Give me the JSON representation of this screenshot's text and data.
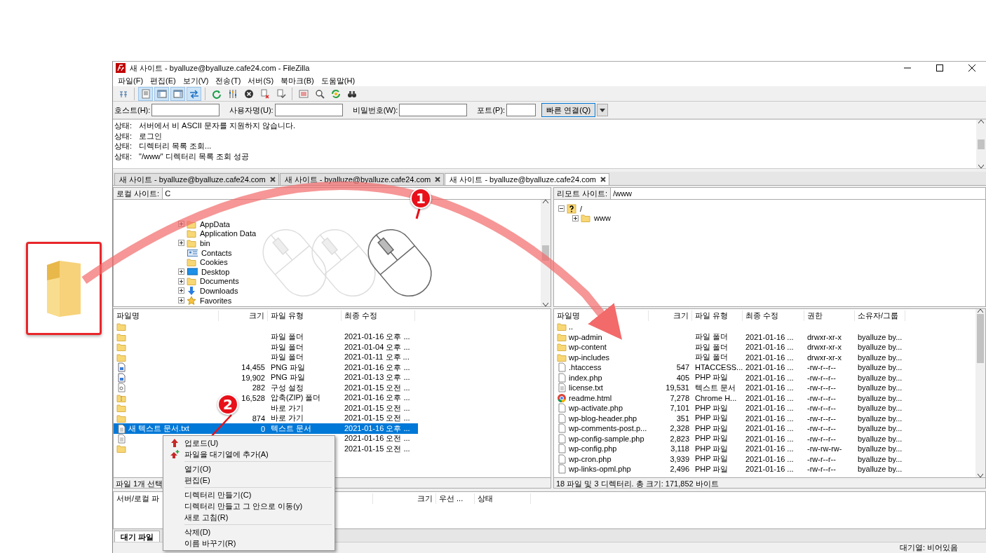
{
  "window": {
    "title": "새 사이트 - byalluze@byalluze.cafe24.com - FileZilla"
  },
  "menu": [
    "파일(F)",
    "편집(E)",
    "보기(V)",
    "전송(T)",
    "서버(S)",
    "북마크(B)",
    "도움말(H)"
  ],
  "toolbar": [
    {
      "kind": "site-manager",
      "on": false
    },
    {
      "kind": "log",
      "on": true
    },
    {
      "kind": "local-tree",
      "on": true
    },
    {
      "kind": "remote-tree",
      "on": true
    },
    {
      "kind": "queue",
      "on": true
    },
    {
      "kind": "refresh",
      "on": false
    },
    {
      "kind": "filter",
      "on": false
    },
    {
      "kind": "cancel",
      "on": false
    },
    {
      "kind": "disconnect",
      "on": false
    },
    {
      "kind": "reconnect",
      "on": false
    },
    {
      "kind": "listing",
      "on": false
    },
    {
      "kind": "search",
      "on": false
    },
    {
      "kind": "sync",
      "on": false
    },
    {
      "kind": "find",
      "on": false
    }
  ],
  "quickconnect": {
    "fields": [
      {
        "label": "호스트(H):"
      },
      {
        "label": "사용자명(U):"
      },
      {
        "label": "비밀번호(W):"
      },
      {
        "label": "포트(P):"
      }
    ],
    "button": "빠른 연결(Q)"
  },
  "log": [
    {
      "label": "상태:",
      "text": "서버에서 비 ASCII 문자를 지원하지 않습니다."
    },
    {
      "label": "상태:",
      "text": "로그인"
    },
    {
      "label": "상태:",
      "text": "디렉터리 목록 조회..."
    },
    {
      "label": "상태:",
      "text": "\"/www\" 디렉터리 목록 조회 성공"
    }
  ],
  "tabs": [
    {
      "label": "새 사이트 - byalluze@byalluze.cafe24.com",
      "selected": false
    },
    {
      "label": "새 사이트 - byalluze@byalluze.cafe24.com",
      "selected": false
    },
    {
      "label": "새 사이트 - byalluze@byalluze.cafe24.com",
      "selected": true
    }
  ],
  "local": {
    "site_label": "로컬 사이트:",
    "path": "C",
    "tree": [
      {
        "name": "AppData",
        "kind": "folder",
        "expandable": true
      },
      {
        "name": "Application Data",
        "kind": "folder",
        "expandable": false
      },
      {
        "name": "bin",
        "kind": "folder",
        "expandable": true
      },
      {
        "name": "Contacts",
        "kind": "contacts",
        "expandable": false
      },
      {
        "name": "Cookies",
        "kind": "folder",
        "expandable": false
      },
      {
        "name": "Desktop",
        "kind": "desktop",
        "expandable": true
      },
      {
        "name": "Documents",
        "kind": "folder",
        "expandable": true
      },
      {
        "name": "Downloads",
        "kind": "downloads",
        "expandable": true
      },
      {
        "name": "Favorites",
        "kind": "favorites",
        "expandable": true
      }
    ],
    "columns": [
      "파일명",
      "크기",
      "파일 유형",
      "최종 수정"
    ],
    "rows": [
      {
        "kind": "folder",
        "selected": false
      },
      {
        "kind": "folder",
        "type": "파일 폴더",
        "modified": "2021-01-16 오후 ...",
        "selected": false
      },
      {
        "kind": "folder",
        "type": "파일 폴더",
        "modified": "2021-01-04 오후 ...",
        "selected": false
      },
      {
        "kind": "folder",
        "type": "파일 폴더",
        "modified": "2021-01-11 오후 ...",
        "selected": false
      },
      {
        "kind": "image",
        "size": "14,455",
        "type": "PNG 파일",
        "modified": "2021-01-16 오후 ...",
        "selected": false
      },
      {
        "kind": "image",
        "size": "19,902",
        "type": "PNG 파일",
        "modified": "2021-01-13 오후 ...",
        "selected": false
      },
      {
        "kind": "config",
        "size": "282",
        "type": "구성 설정",
        "modified": "2021-01-15 오전 ...",
        "selected": false
      },
      {
        "kind": "zip",
        "size": "16,528",
        "type": "압축(ZIP) 폴더",
        "modified": "2021-01-16 오후 ...",
        "selected": false
      },
      {
        "kind": "folder",
        "type": "바로 가기",
        "modified": "2021-01-15 오전 ...",
        "selected": false
      },
      {
        "kind": "folder",
        "size": "874",
        "type": "바로 가기",
        "modified": "2021-01-15 오전 ...",
        "selected": false
      },
      {
        "kind": "text",
        "name": "새 텍스트 문서.txt",
        "size": "0",
        "type": "텍스트 문서",
        "modified": "2021-01-16 오후 ...",
        "selected": true
      },
      {
        "kind": "text",
        "modified": "2021-01-16 오전 ...",
        "selected": false
      },
      {
        "kind": "folder",
        "modified": "2021-01-15 오전 ...",
        "selected": false
      }
    ],
    "status": "파일 1개 선택"
  },
  "remote": {
    "site_label": "리모트 사이트:",
    "path": "/www",
    "tree": [
      {
        "name": "/",
        "kind": "unknown",
        "expandable": true,
        "children": [
          {
            "name": "www",
            "kind": "folder",
            "expandable": true
          }
        ]
      }
    ],
    "columns": [
      "파일명",
      "크기",
      "파일 유형",
      "최종 수정",
      "권한",
      "소유자/그룹"
    ],
    "rows": [
      {
        "kind": "folder",
        "name": ".."
      },
      {
        "kind": "folder",
        "name": "wp-admin",
        "type": "파일 폴더",
        "modified": "2021-01-16 ...",
        "perms": "drwxr-xr-x",
        "owner": "byalluze by..."
      },
      {
        "kind": "folder",
        "name": "wp-content",
        "type": "파일 폴더",
        "modified": "2021-01-16 ...",
        "perms": "drwxr-xr-x",
        "owner": "byalluze by..."
      },
      {
        "kind": "folder",
        "name": "wp-includes",
        "type": "파일 폴더",
        "modified": "2021-01-16 ...",
        "perms": "drwxr-xr-x",
        "owner": "byalluze by..."
      },
      {
        "kind": "file",
        "name": ".htaccess",
        "size": "547",
        "type": "HTACCESS...",
        "modified": "2021-01-16 ...",
        "perms": "-rw-r--r--",
        "owner": "byalluze by..."
      },
      {
        "kind": "file",
        "name": "index.php",
        "size": "405",
        "type": "PHP 파일",
        "modified": "2021-01-16 ...",
        "perms": "-rw-r--r--",
        "owner": "byalluze by..."
      },
      {
        "kind": "text",
        "name": "license.txt",
        "size": "19,531",
        "type": "텍스트 문서",
        "modified": "2021-01-16 ...",
        "perms": "-rw-r--r--",
        "owner": "byalluze by..."
      },
      {
        "kind": "browser",
        "name": "readme.html",
        "size": "7,278",
        "type": "Chrome H...",
        "modified": "2021-01-16 ...",
        "perms": "-rw-r--r--",
        "owner": "byalluze by..."
      },
      {
        "kind": "file",
        "name": "wp-activate.php",
        "size": "7,101",
        "type": "PHP 파일",
        "modified": "2021-01-16 ...",
        "perms": "-rw-r--r--",
        "owner": "byalluze by..."
      },
      {
        "kind": "file",
        "name": "wp-blog-header.php",
        "size": "351",
        "type": "PHP 파일",
        "modified": "2021-01-16 ...",
        "perms": "-rw-r--r--",
        "owner": "byalluze by..."
      },
      {
        "kind": "file",
        "name": "wp-comments-post.p...",
        "size": "2,328",
        "type": "PHP 파일",
        "modified": "2021-01-16 ...",
        "perms": "-rw-r--r--",
        "owner": "byalluze by..."
      },
      {
        "kind": "file",
        "name": "wp-config-sample.php",
        "size": "2,823",
        "type": "PHP 파일",
        "modified": "2021-01-16 ...",
        "perms": "-rw-r--r--",
        "owner": "byalluze by..."
      },
      {
        "kind": "file",
        "name": "wp-config.php",
        "size": "3,118",
        "type": "PHP 파일",
        "modified": "2021-01-16 ...",
        "perms": "-rw-rw-rw-",
        "owner": "byalluze by..."
      },
      {
        "kind": "file",
        "name": "wp-cron.php",
        "size": "3,939",
        "type": "PHP 파일",
        "modified": "2021-01-16 ...",
        "perms": "-rw-r--r--",
        "owner": "byalluze by..."
      },
      {
        "kind": "file",
        "name": "wp-links-opml.php",
        "size": "2,496",
        "type": "PHP 파일",
        "modified": "2021-01-16 ...",
        "perms": "-rw-r--r--",
        "owner": "byalluze by..."
      }
    ],
    "status": "18 파일 및 3 디렉터리. 총 크기: 171,852 바이트"
  },
  "queue": {
    "columns": [
      "서버/로컬 파",
      "크기",
      "우선 ...",
      "상태"
    ],
    "tabs": [
      {
        "label": "대기 파일",
        "selected": true
      }
    ]
  },
  "status_bar": "대기열: 비어있음",
  "context_menu": {
    "groups": [
      [
        {
          "label": "업로드(U)",
          "kind": "upload"
        },
        {
          "label": "파일을 대기열에 추가(A)",
          "kind": "queue-add"
        }
      ],
      [
        {
          "label": "열기(O)"
        },
        {
          "label": "편집(E)"
        }
      ],
      [
        {
          "label": "디렉터리 만들기(C)"
        },
        {
          "label": "디렉터리 만들고 그 안으로 이동(y)"
        },
        {
          "label": "새로 고침(R)"
        }
      ],
      [
        {
          "label": "삭제(D)"
        },
        {
          "label": "이름 바꾸기(R)"
        }
      ]
    ]
  },
  "annotations": [
    {
      "label": "1"
    },
    {
      "label": "2"
    }
  ]
}
